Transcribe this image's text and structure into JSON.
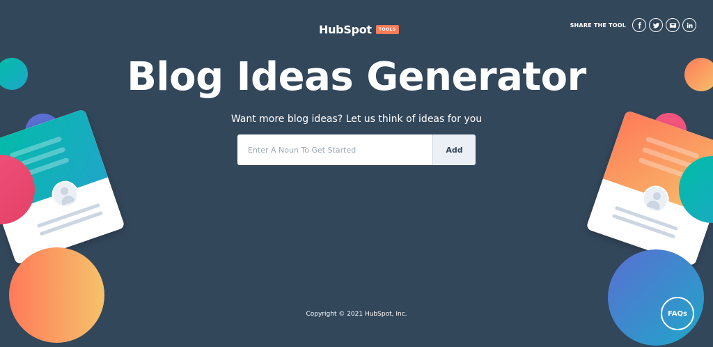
{
  "header": {
    "logo_text": "HubSpot",
    "logo_badge": "TOOLS",
    "share_label": "SHARE THE TOOL",
    "share_icons": [
      "facebook-icon",
      "twitter-icon",
      "email-icon",
      "linkedin-icon"
    ]
  },
  "hero": {
    "title": "Blog Ideas Generator",
    "subtitle": "Want more blog ideas? Let us think of ideas for you"
  },
  "search": {
    "placeholder": "Enter A Noun To Get Started",
    "value": "",
    "button_label": "Add"
  },
  "footer": {
    "copyright": "Copyright © 2021 HubSpot, Inc."
  },
  "faq": {
    "label": "FAQs"
  },
  "colors": {
    "background": "#33475b",
    "accent": "#ff7a59",
    "teal": "#00bda5",
    "button_bg": "#eaf0f6"
  }
}
